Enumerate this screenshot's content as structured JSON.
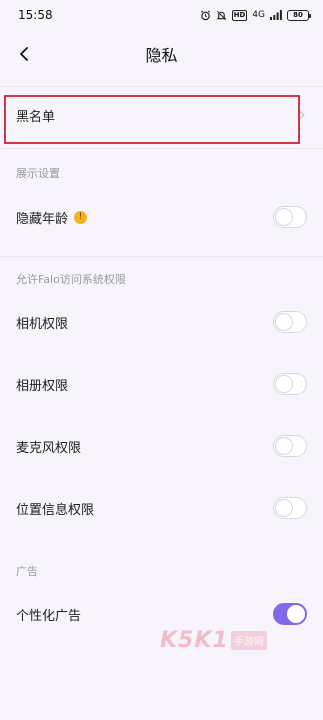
{
  "status_bar": {
    "time": "15:58",
    "signal": "4G",
    "hd": "HD",
    "battery": "80"
  },
  "nav": {
    "title": "隐私"
  },
  "blacklist": {
    "label": "黑名单"
  },
  "display_section": {
    "header": "展示设置",
    "items": [
      {
        "label": "隐藏年龄",
        "icon": "shocked-emoji-icon",
        "enabled": false
      }
    ]
  },
  "permissions_section": {
    "header": "允许Falo访问系统权限",
    "items": [
      {
        "label": "相机权限",
        "enabled": false
      },
      {
        "label": "相册权限",
        "enabled": false
      },
      {
        "label": "麦克风权限",
        "enabled": false
      },
      {
        "label": "位置信息权限",
        "enabled": false
      }
    ]
  },
  "ads_section": {
    "header": "广告",
    "items": [
      {
        "label": "个性化广告",
        "enabled": true
      }
    ]
  },
  "watermark": {
    "brand": "K5K1",
    "subtitle": "手游网"
  },
  "colors": {
    "accent": "#8069e8",
    "highlight": "#d4344a",
    "background": "#f7f5fb"
  }
}
